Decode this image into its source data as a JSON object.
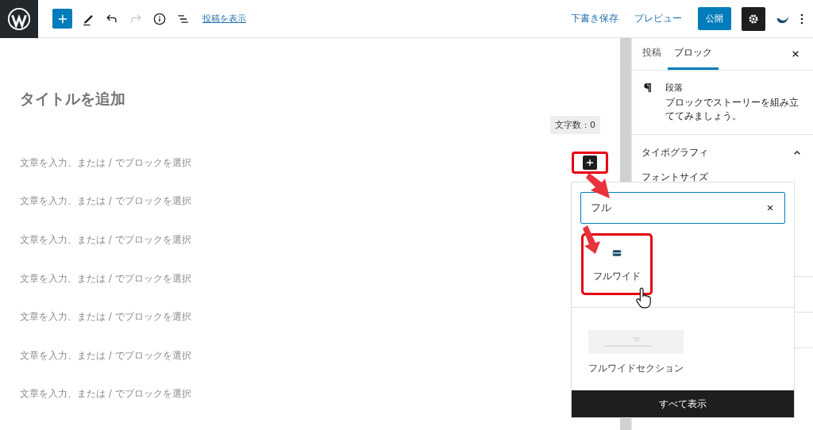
{
  "topbar": {
    "view_post_link": "投稿を表示",
    "save_draft": "下書き保存",
    "preview": "プレビュー",
    "publish": "公開",
    "redo_disabled": true
  },
  "editor": {
    "title_placeholder": "タイトルを追加",
    "word_count": "文字数 : 0",
    "paragraphs": [
      "文章を入力、または / でブロックを選択",
      "文章を入力、または / でブロックを選択",
      "文章を入力、または / でブロックを選択",
      "文章を入力、または / でブロックを選択",
      "文章を入力、または / でブロックを選択",
      "文章を入力、または / でブロックを選択",
      "文章を入力、または / でブロックを選択"
    ]
  },
  "sidebar": {
    "tabs": [
      {
        "label": "投稿",
        "selected": false
      },
      {
        "label": "ブロック",
        "selected": true
      }
    ],
    "block": {
      "name": "段落",
      "description": "ブロックでストーリーを組み立ててみましょう。"
    },
    "panels": [
      {
        "title": "タイポグラフィ",
        "expanded": true,
        "items": [
          "フォントサイズ"
        ]
      }
    ]
  },
  "inserter": {
    "search": {
      "value": "フル"
    },
    "blocks": [
      {
        "label": "フルワイド",
        "highlighted": true
      }
    ],
    "patterns": [
      {
        "label": "フルワイドセクション"
      }
    ],
    "footer_button": "すべて表示"
  }
}
